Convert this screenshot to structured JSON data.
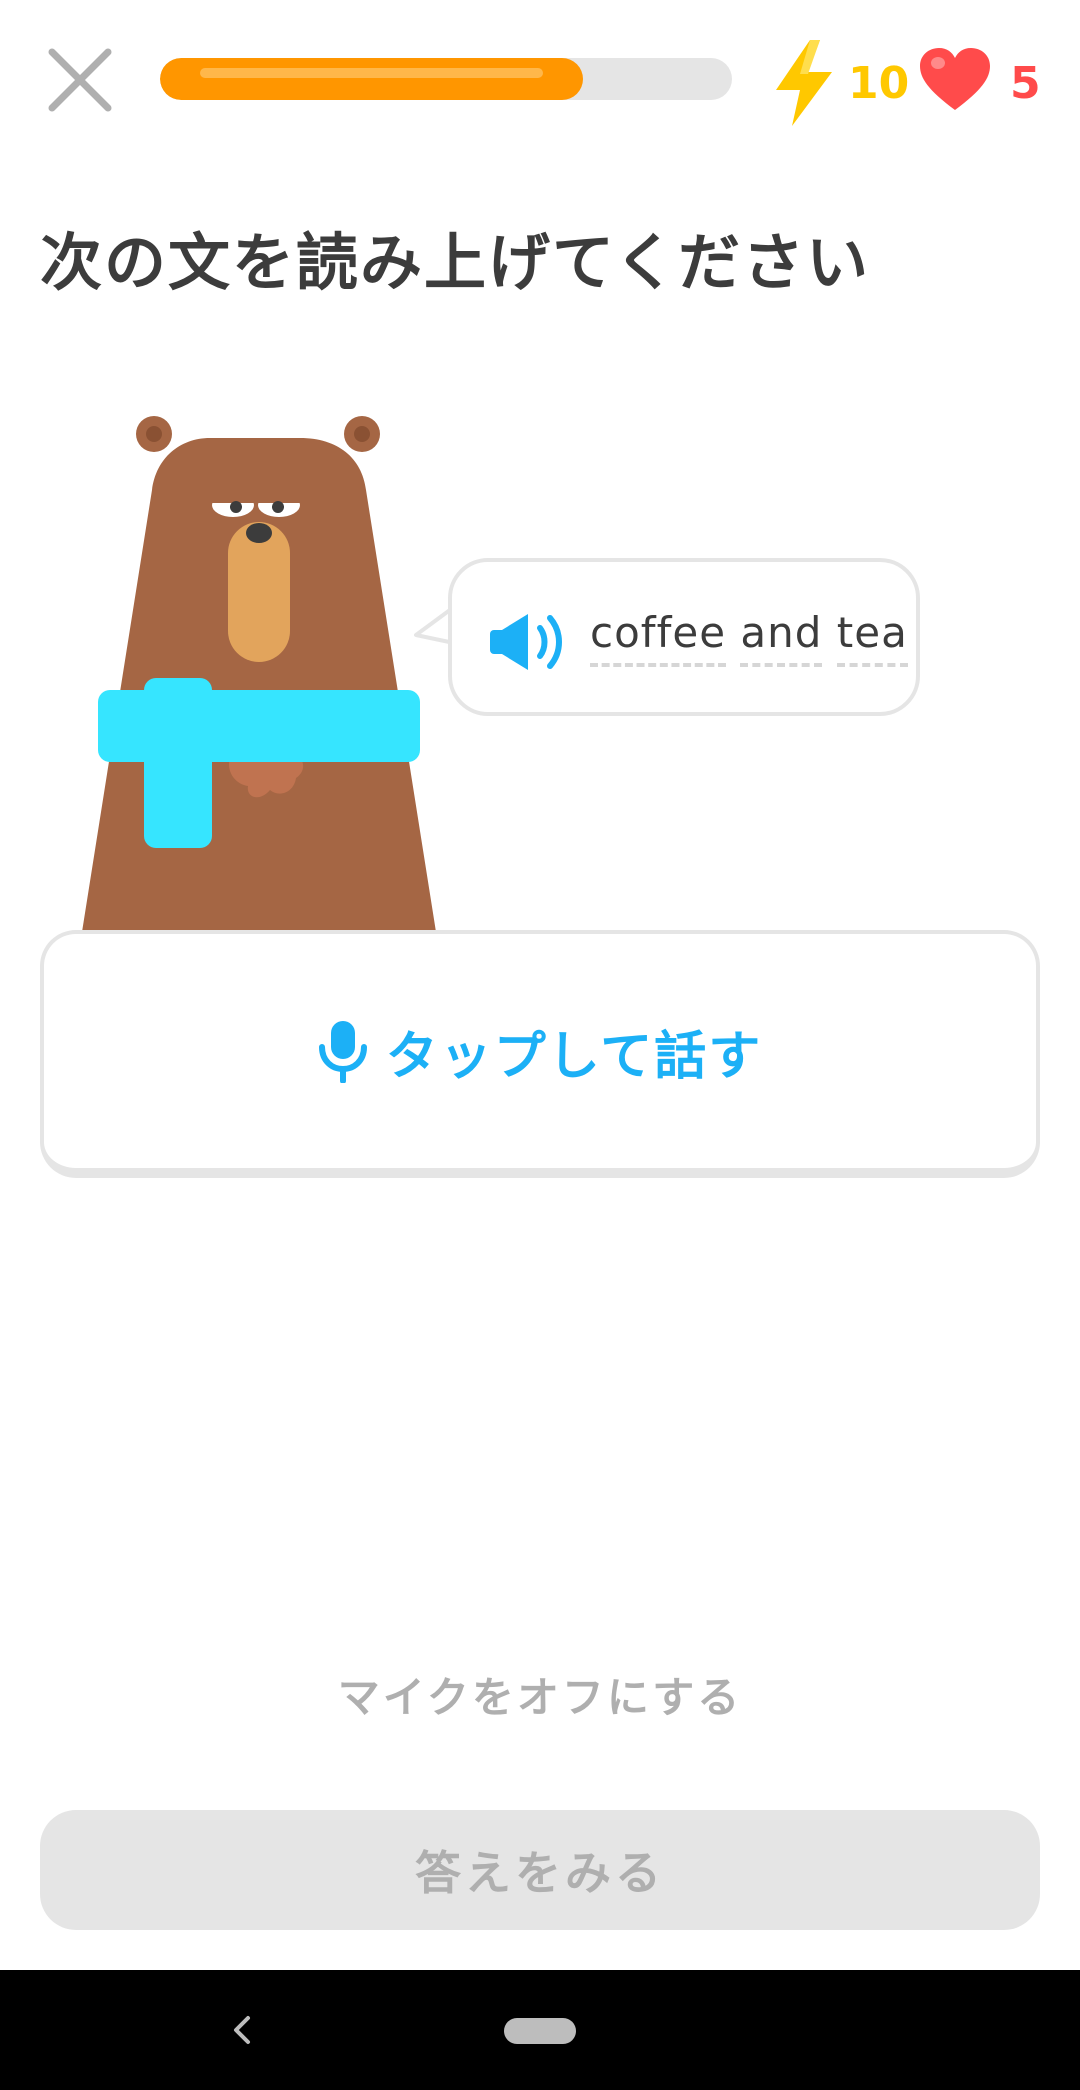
{
  "header": {
    "progress_value": 0.74,
    "streak_count": "10",
    "hearts_count": "5"
  },
  "prompt": "次の文を読み上げてください",
  "bubble": {
    "words": [
      "coffee",
      "and",
      "tea"
    ]
  },
  "tap_to_speak": "タップして話す",
  "mic_off": "マイクをオフにする",
  "check_button": "答えをみる",
  "colors": {
    "progress": "#ff9600",
    "streak": "#ffc800",
    "hearts": "#ff4b4b",
    "accent": "#1cb0f6",
    "scarf": "#36e5ff",
    "bear": "#a56644"
  },
  "icons": [
    "close-icon",
    "lightning-icon",
    "heart-icon",
    "speaker-icon",
    "microphone-icon",
    "back-icon"
  ]
}
